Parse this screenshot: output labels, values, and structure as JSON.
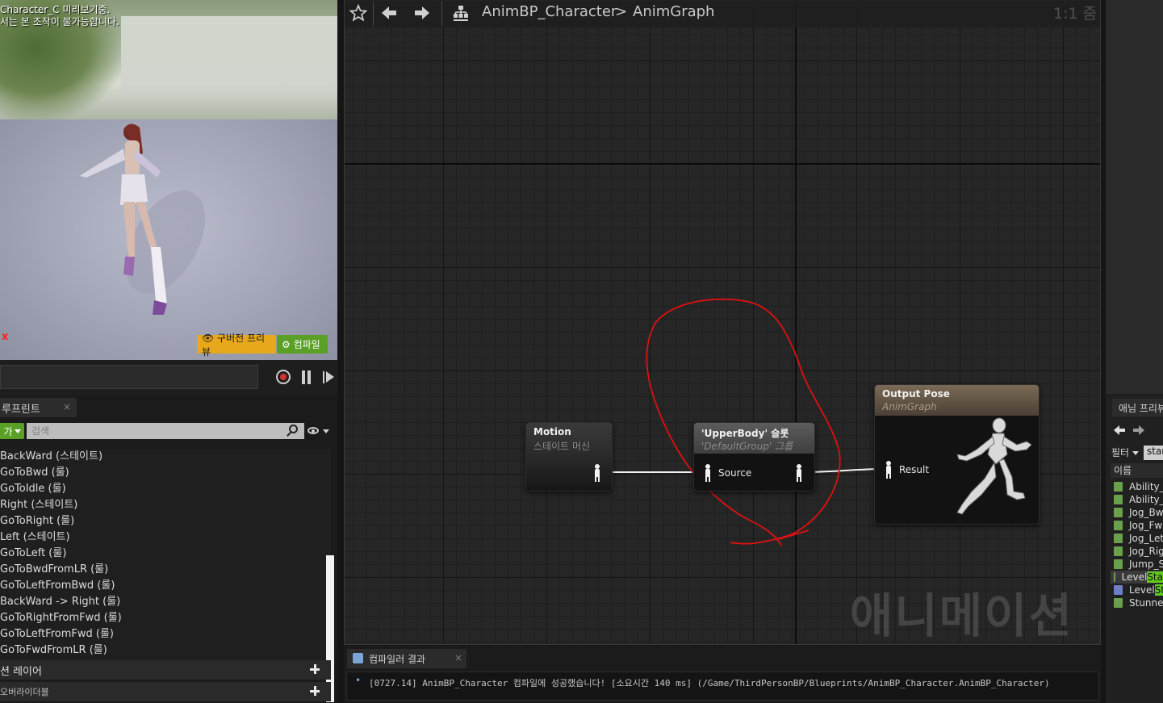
{
  "viewport": {
    "info_line1": "Character_C 미리보기중.",
    "info_line2": "서는 본 조작이 불가능합니다.",
    "axis_label": "x",
    "preview_button": "👁 구버전 프리뷰",
    "compile_button": "⚙ 컴파일"
  },
  "my_blueprint": {
    "tab_label": "루프린트",
    "tab_close": "×",
    "add_button": "가",
    "search_placeholder": "검색",
    "items": [
      "BackWard (스테이트)",
      "GoToBwd (룰)",
      "GoToIdle (룰)",
      "Right (스테이트)",
      "GoToRight (룰)",
      "Left (스테이트)",
      "GoToLeft (룰)",
      "GoToBwdFromLR (룰)",
      "GoToLeftFromBwd (룰)",
      "BackWard -> Right (룰)",
      "GoToRightFromFwd (룰)",
      "GoToLeftFromFwd (룰)",
      "GoToFwdFromLR (룰)"
    ],
    "section_layers": "션 레이어",
    "section_overrides": "오버라이더블"
  },
  "graph": {
    "breadcrumb_asset": "AnimBP_Character",
    "breadcrumb_separator": ">",
    "breadcrumb_graph": "AnimGraph",
    "zoom_level": "1:1 줌",
    "watermark": "애니메이션",
    "icons": {
      "favorite": "star-icon",
      "back": "arrow-left-icon",
      "forward": "arrow-right-icon",
      "graph_type": "blueprint-hierarchy-icon"
    },
    "nodes": {
      "motion": {
        "title": "Motion",
        "subtitle": "스테이트 머신"
      },
      "slot": {
        "title": "'UpperBody' 슬롯",
        "subtitle": "'DefaultGroup' 그룹",
        "input_pin": "Source"
      },
      "output": {
        "title": "Output Pose",
        "subtitle": "AnimGraph",
        "input_pin": "Result"
      }
    },
    "annotation_color": "#e01010"
  },
  "compiler": {
    "tab_label": "컴파일러 결과",
    "tab_close": "×",
    "message": "[0727.14] AnimBP_Character 컴파일에 성공했습니다! [소요시간 140 ms] (/Game/ThirdPersonBP/Blueprints/AnimBP_Character.AnimBP_Character)"
  },
  "anim_preview": {
    "tab_label": "애님 프리뷰",
    "filter_label": "필터",
    "search_value": "star",
    "column_name": "이름",
    "items": [
      {
        "label": "Ability_",
        "highlight": ""
      },
      {
        "label": "Ability_",
        "highlight": ""
      },
      {
        "label": "Jog_Bw",
        "highlight": ""
      },
      {
        "label": "Jog_Fw",
        "highlight": ""
      },
      {
        "label": "Jog_Let",
        "highlight": ""
      },
      {
        "label": "Jog_Rig",
        "highlight": ""
      },
      {
        "label": "Jump_S",
        "highlight": ""
      },
      {
        "label": "Level",
        "highlight": "Sta"
      },
      {
        "label": "Level",
        "highlight": "Sta"
      },
      {
        "label": "Stunned",
        "highlight": ""
      }
    ]
  }
}
